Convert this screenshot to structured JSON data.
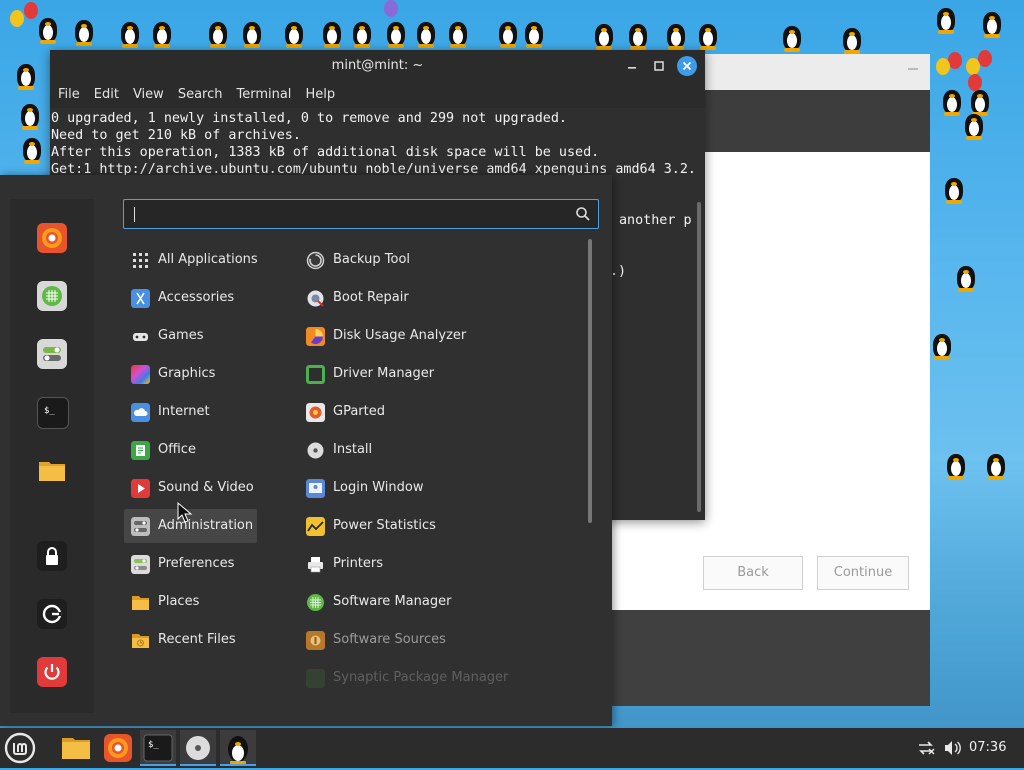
{
  "terminal": {
    "title": "mint@mint: ~",
    "menu": [
      "File",
      "Edit",
      "View",
      "Search",
      "Terminal",
      "Help"
    ],
    "lines": [
      "0 upgraded, 1 newly installed, 0 to remove and 299 not upgraded.",
      "Need to get 210 kB of archives.",
      "After this operation, 1383 kB of additional disk space will be used.",
      "Get:1 http://archive.ubuntu.com/ubuntu noble/universe amd64 xpenguins amd64 3.2."
    ],
    "partial_right_1": "another p",
    "partial_right_2": ".)"
  },
  "installer": {
    "back_label": "Back",
    "continue_label": "Continue"
  },
  "menu": {
    "search_value": "",
    "categories": [
      {
        "label": "All Applications",
        "icon": "grid-icon",
        "color": "#dcdcdc"
      },
      {
        "label": "Accessories",
        "icon": "scissors-icon",
        "color": "#4a90e2"
      },
      {
        "label": "Games",
        "icon": "gamepad-icon",
        "color": "#dcdcdc"
      },
      {
        "label": "Graphics",
        "icon": "palette-icon",
        "color": "#c04fd0"
      },
      {
        "label": "Internet",
        "icon": "cloud-icon",
        "color": "#4a90e2"
      },
      {
        "label": "Office",
        "icon": "document-icon",
        "color": "#3aa845"
      },
      {
        "label": "Sound & Video",
        "icon": "play-icon",
        "color": "#e03a3a"
      },
      {
        "label": "Administration",
        "icon": "toggle-icon",
        "color": "#bdbdbd"
      },
      {
        "label": "Preferences",
        "icon": "switches-icon",
        "color": "#8cc05a"
      },
      {
        "label": "Places",
        "icon": "folder-icon",
        "color": "#f0b33a"
      },
      {
        "label": "Recent Files",
        "icon": "clock-folder-icon",
        "color": "#f0b33a"
      }
    ],
    "apps": [
      {
        "label": "Backup Tool",
        "icon": "backup-icon",
        "color": "#d0d0d0"
      },
      {
        "label": "Boot Repair",
        "icon": "boot-repair-icon",
        "color": "#9aa6b8"
      },
      {
        "label": "Disk Usage Analyzer",
        "icon": "disk-usage-icon",
        "color": "#f08a24"
      },
      {
        "label": "Driver Manager",
        "icon": "driver-icon",
        "color": "#4caf50"
      },
      {
        "label": "GParted",
        "icon": "gparted-icon",
        "color": "#e65a2a"
      },
      {
        "label": "Install",
        "icon": "disc-icon",
        "color": "#d8d8d8"
      },
      {
        "label": "Login Window",
        "icon": "login-window-icon",
        "color": "#5a88d8"
      },
      {
        "label": "Power Statistics",
        "icon": "power-stats-icon",
        "color": "#f0c030"
      },
      {
        "label": "Printers",
        "icon": "printer-icon",
        "color": "#e8e8e8"
      },
      {
        "label": "Software Manager",
        "icon": "software-manager-icon",
        "color": "#5fb946"
      },
      {
        "label": "Software Sources",
        "icon": "software-sources-icon",
        "color": "#d08a30"
      },
      {
        "label": "Synaptic Package Manager",
        "icon": "synaptic-icon",
        "color": "#3e7a3e"
      }
    ]
  },
  "panel": {
    "clock": "07:36"
  },
  "colors": {
    "accent": "#4aa0e8",
    "menu_bg": "#303030",
    "terminal_bg": "#2f2f2f"
  }
}
